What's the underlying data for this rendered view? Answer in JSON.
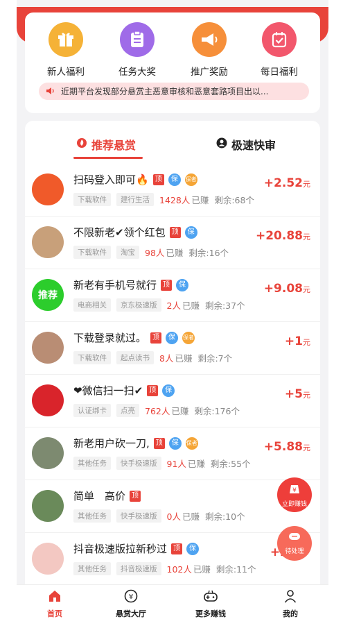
{
  "colors": {
    "accent": "#e8433a",
    "gift": "#f5b237",
    "task": "#9f6be8",
    "promo": "#f68f3a",
    "daily": "#f2576c"
  },
  "quick_menu": [
    {
      "label": "新人福利",
      "icon": "gift-icon"
    },
    {
      "label": "任务大奖",
      "icon": "clipboard-icon"
    },
    {
      "label": "推广奖励",
      "icon": "megaphone-icon"
    },
    {
      "label": "每日福利",
      "icon": "calendar-check-icon"
    }
  ],
  "notice": {
    "icon": "speaker-icon",
    "text": "近期平台发现部分悬赏主恶意审核和恶意套路项目出以..."
  },
  "tabs": [
    {
      "label": "推荐悬赏",
      "icon": "flame-icon",
      "active": true
    },
    {
      "label": "极速快审",
      "icon": "user-circle-icon",
      "active": false
    }
  ],
  "badges": {
    "top": "顶",
    "bao": "保",
    "vip": "保者"
  },
  "tasks": [
    {
      "title": "扫码登入即可🔥",
      "tags": [
        "下载软件",
        "建行生活"
      ],
      "count": "1428人",
      "earned": "已赚",
      "remaining": "剩余:68个",
      "price": "+2.52",
      "unit": "元",
      "vip": true,
      "avatar_text": "",
      "avatar_color": "#f05a2a"
    },
    {
      "title": "不限新老✔领个红包",
      "tags": [
        "下载软件",
        "淘宝"
      ],
      "count": "98人",
      "earned": "已赚",
      "remaining": "剩余:16个",
      "price": "+20.88",
      "unit": "元",
      "vip": false,
      "avatar_text": "",
      "avatar_color": "#c8a07a"
    },
    {
      "title": "新老有手机号就行",
      "tags": [
        "电商相关",
        "京东极速版"
      ],
      "count": "2人",
      "earned": "已赚",
      "remaining": "剩余:37个",
      "price": "+9.08",
      "unit": "元",
      "vip": false,
      "avatar_text": "推荐",
      "avatar_color": "#2ccd2c"
    },
    {
      "title": "下载登录就过。",
      "tags": [
        "下载软件",
        "起点读书"
      ],
      "count": "8人",
      "earned": "已赚",
      "remaining": "剩余:7个",
      "price": "+1",
      "unit": "元",
      "vip": true,
      "avatar_text": "",
      "avatar_color": "#b98d74"
    },
    {
      "title": "❤微信扫一扫✔",
      "tags": [
        "认证绑卡",
        "点亮"
      ],
      "count": "762人",
      "earned": "已赚",
      "remaining": "剩余:176个",
      "price": "+5",
      "unit": "元",
      "vip": false,
      "avatar_text": "",
      "avatar_color": "#d9242b"
    },
    {
      "title": "新老用户砍一刀,",
      "tags": [
        "其他任务",
        "快手极速版"
      ],
      "count": "91人",
      "earned": "已赚",
      "remaining": "剩余:55个",
      "price": "+5.88",
      "unit": "元",
      "vip": true,
      "avatar_text": "",
      "avatar_color": "#7d8a70"
    },
    {
      "title": "简单　高价",
      "tags": [
        "其他任务",
        "快手极速版"
      ],
      "count": "0人",
      "earned": "已赚",
      "remaining": "剩余:10个",
      "price": "",
      "unit": "",
      "vip": false,
      "no_bao": true,
      "avatar_text": "",
      "avatar_color": "#6a8a5a"
    },
    {
      "title": "抖音极速版拉新秒过",
      "tags": [
        "其他任务",
        "抖音极速版"
      ],
      "count": "102人",
      "earned": "已赚",
      "remaining": "剩余:11个",
      "price": "+2",
      "unit": "",
      "vip": false,
      "avatar_text": "",
      "avatar_color": "#f3c8c2"
    }
  ],
  "floating": [
    {
      "label": "立即赚钱",
      "icon": "yen-pouch-icon"
    },
    {
      "label": "待处理",
      "icon": "message-icon"
    }
  ],
  "tabbar": [
    {
      "label": "首页",
      "icon": "home-icon",
      "active": true
    },
    {
      "label": "悬赏大厅",
      "icon": "yen-circle-icon",
      "active": false
    },
    {
      "label": "更多赚钱",
      "icon": "gamepad-icon",
      "active": false
    },
    {
      "label": "我的",
      "icon": "person-icon",
      "active": false
    }
  ]
}
